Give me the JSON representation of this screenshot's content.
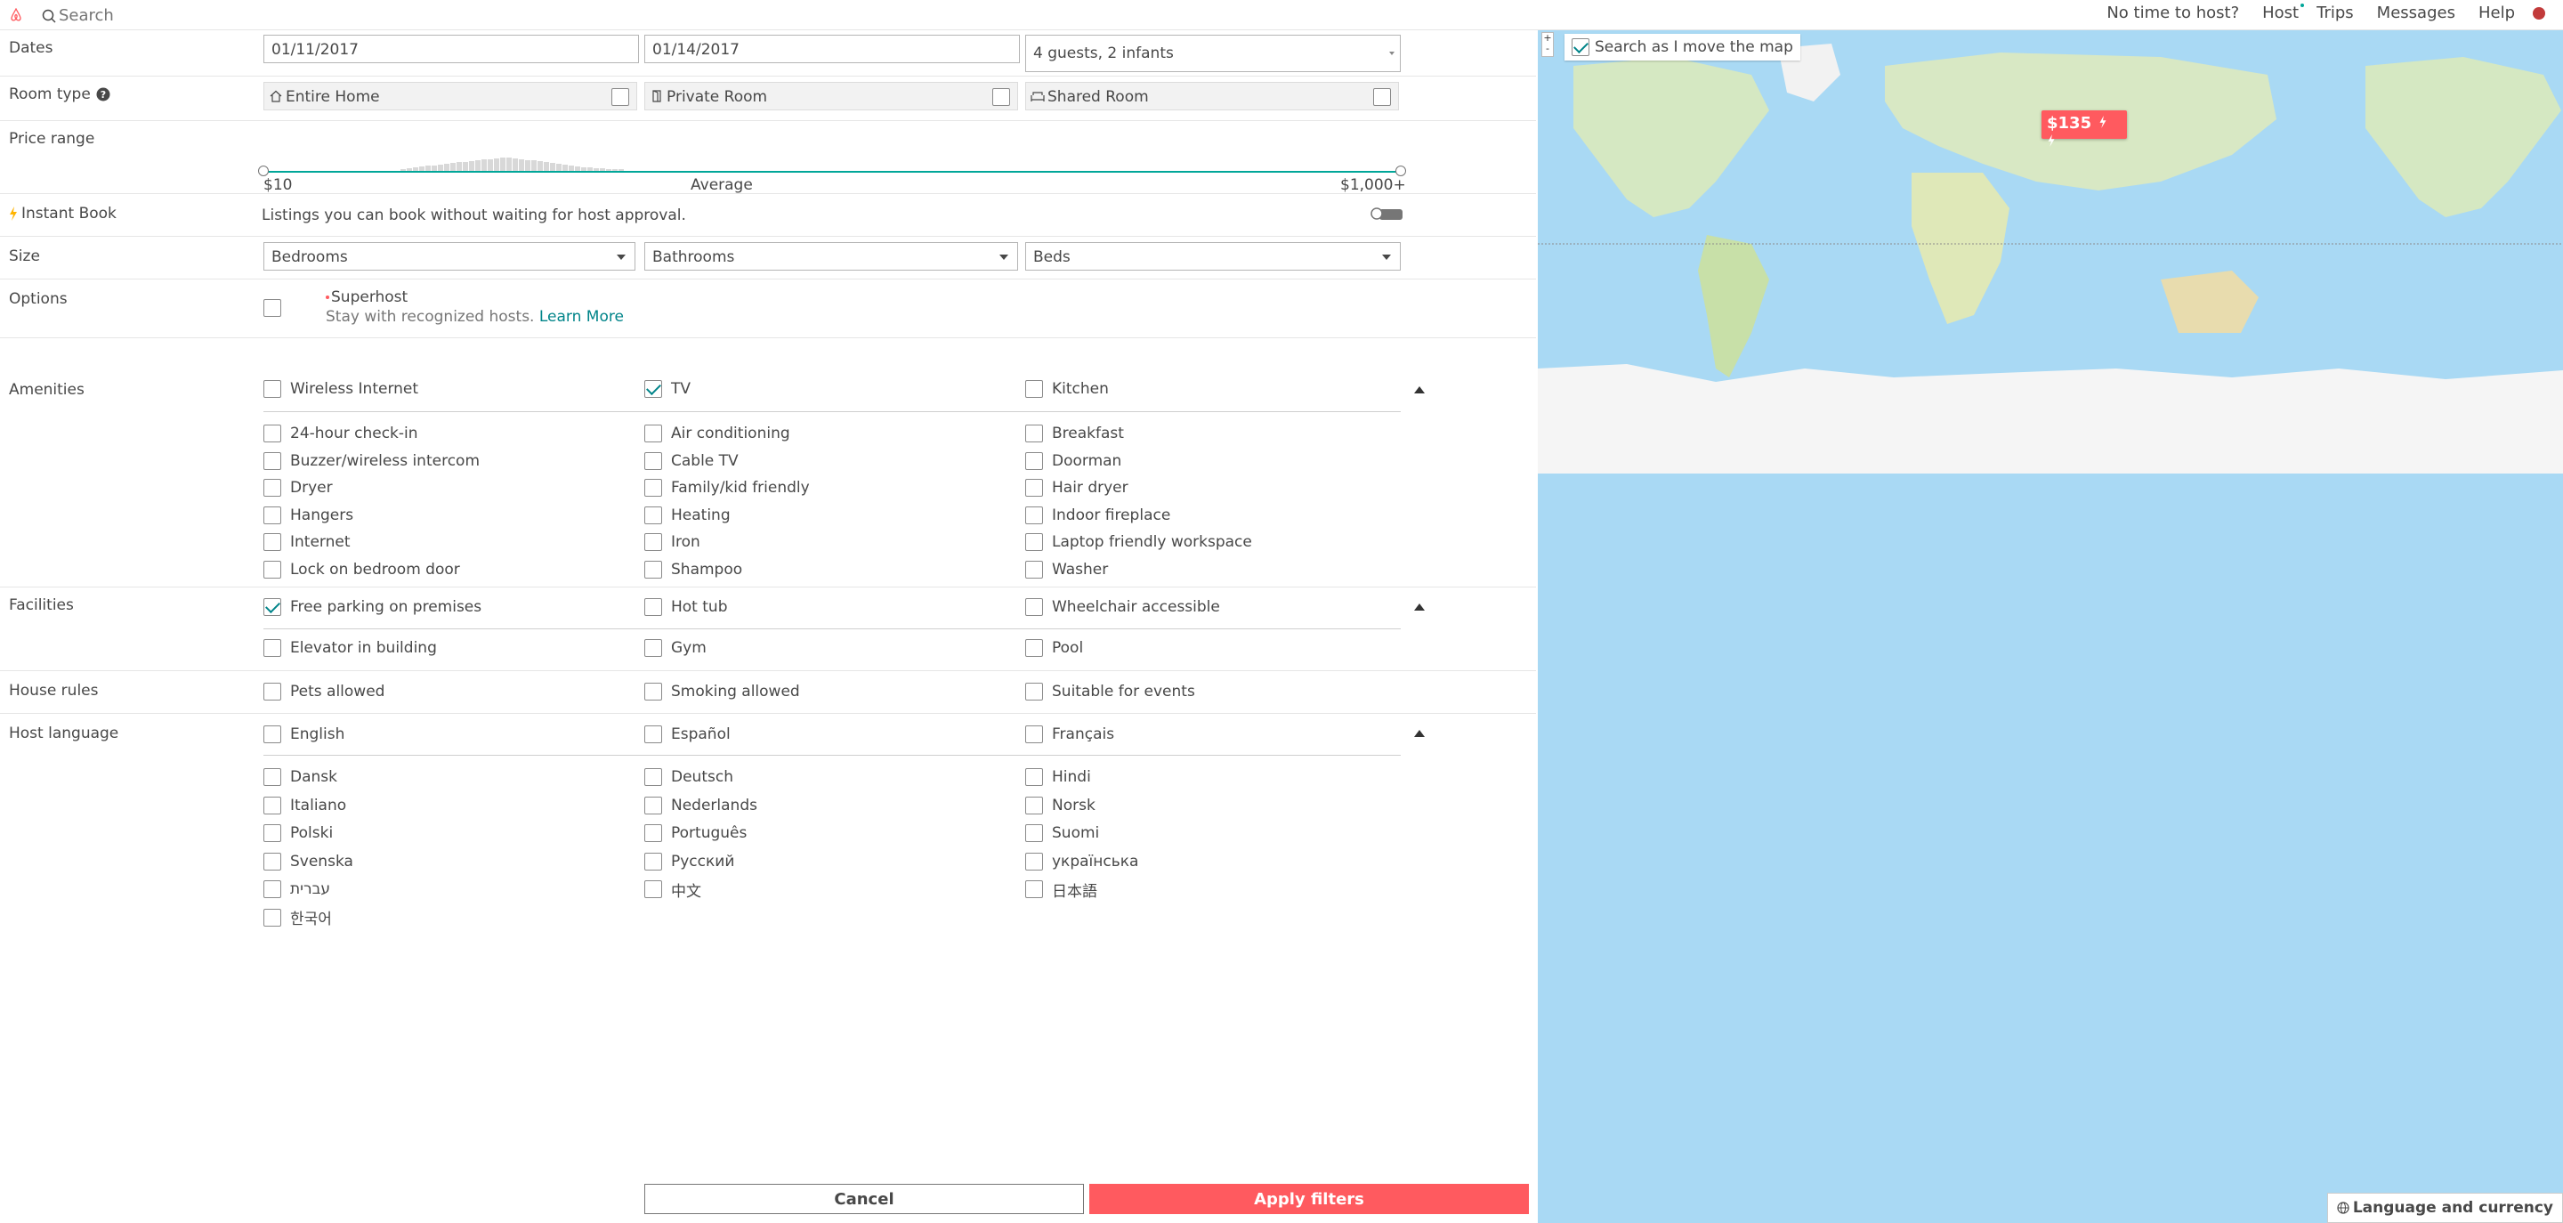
{
  "topbar": {
    "search_placeholder": "Search",
    "nav": [
      "No time to host?",
      "Host",
      "Trips",
      "Messages",
      "Help"
    ]
  },
  "filters": {
    "dates": {
      "label": "Dates",
      "checkin": "01/11/2017",
      "checkout": "01/14/2017",
      "guests": "4 guests, 2 infants"
    },
    "room_type": {
      "label": "Room type",
      "options": [
        "Entire Home",
        "Private Room",
        "Shared Room"
      ]
    },
    "price_range": {
      "label": "Price range",
      "min": "$10",
      "avg": "Average",
      "max": "$1,000+"
    },
    "instant_book": {
      "label": "Instant Book",
      "description": "Listings you can book without waiting for host approval."
    },
    "size": {
      "label": "Size",
      "bedrooms": "Bedrooms",
      "bathrooms": "Bathrooms",
      "beds": "Beds"
    },
    "options": {
      "label": "Options",
      "superhost": "Superhost",
      "superhost_desc": "Stay with recognized hosts.",
      "learn_more": "Learn More"
    },
    "amenities": {
      "label": "Amenities",
      "top": [
        [
          "Wireless Internet",
          false
        ],
        [
          "TV",
          true
        ],
        [
          "Kitchen",
          false
        ]
      ],
      "col1": [
        "24-hour check-in",
        "Buzzer/wireless intercom",
        "Dryer",
        "Hangers",
        "Internet",
        "Lock on bedroom door"
      ],
      "col2": [
        "Air conditioning",
        "Cable TV",
        "Family/kid friendly",
        "Heating",
        "Iron",
        "Shampoo"
      ],
      "col3": [
        "Breakfast",
        "Doorman",
        "Hair dryer",
        "Indoor fireplace",
        "Laptop friendly workspace",
        "Washer"
      ]
    },
    "facilities": {
      "label": "Facilities",
      "top": [
        [
          "Free parking on premises",
          true
        ],
        [
          "Hot tub",
          false
        ],
        [
          "Wheelchair accessible",
          false
        ]
      ],
      "more": [
        "Elevator in building",
        "Gym",
        "Pool"
      ]
    },
    "house_rules": {
      "label": "House rules",
      "items": [
        "Pets allowed",
        "Smoking allowed",
        "Suitable for events"
      ]
    },
    "host_language": {
      "label": "Host language",
      "top": [
        "English",
        "Español",
        "Français"
      ],
      "col1": [
        "Dansk",
        "Italiano",
        "Polski",
        "Svenska",
        "עברית",
        "한국어"
      ],
      "col2": [
        "Deutsch",
        "Nederlands",
        "Português",
        "Русский",
        "中文"
      ],
      "col3": [
        "Hindi",
        "Norsk",
        "Suomi",
        "українська",
        "日本語"
      ]
    }
  },
  "buttons": {
    "cancel": "Cancel",
    "apply": "Apply filters"
  },
  "map": {
    "search_as_move": "Search as I move the map",
    "price_pin": "$135",
    "language_currency": "Language and currency"
  },
  "colors": {
    "brand": "#ff5a5f",
    "teal": "#008489",
    "map_water": "#a9d9f4"
  }
}
